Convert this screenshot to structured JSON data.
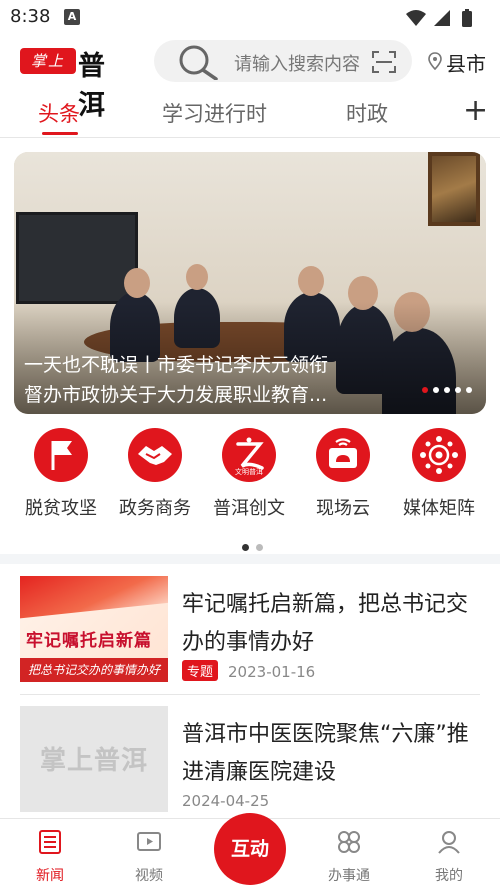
{
  "status_bar": {
    "time": "8:38",
    "notification_icon": "A"
  },
  "header": {
    "logo_badge": "掌上",
    "logo_name": "普洱",
    "search_placeholder": "请输入搜索内容",
    "location_label": "县市"
  },
  "tabs": [
    {
      "label": "头条",
      "active": true
    },
    {
      "label": "学习进行时",
      "active": false
    },
    {
      "label": "时政",
      "active": false
    }
  ],
  "banner": {
    "caption_line1": "一天也不耽误丨市委书记李庆元领衔",
    "caption_line2": "督办市政协关于大力发展职业教育...",
    "slide_count": 5,
    "active_slide": 1
  },
  "shortcuts": [
    {
      "label": "脱贫攻坚",
      "icon": "flag-icon"
    },
    {
      "label": "政务商务",
      "icon": "handshake-icon"
    },
    {
      "label": "普洱创文",
      "icon": "civilization-icon",
      "icon_text": "文明普洱"
    },
    {
      "label": "现场云",
      "icon": "live-cloud-icon"
    },
    {
      "label": "媒体矩阵",
      "icon": "media-matrix-icon"
    }
  ],
  "shortcut_pages": 2,
  "news": [
    {
      "title": "牢记嘱托启新篇，把总书记交办的事情办好",
      "tag": "专题",
      "date": "2023-01-16",
      "thumb_line1": "牢记嘱托启新篇",
      "thumb_line2": "把总书记交办的事情办好"
    },
    {
      "title": "普洱市中医医院聚焦“六廉”推进清廉医院建设",
      "tag": "",
      "date": "2024-04-25",
      "thumb_placeholder": "掌上普洱"
    }
  ],
  "bottom_nav": [
    {
      "label": "新闻",
      "icon": "news-icon",
      "active": true
    },
    {
      "label": "视频",
      "icon": "video-icon",
      "active": false
    },
    {
      "label": "互动",
      "icon": "interact-button",
      "active": false
    },
    {
      "label": "办事通",
      "icon": "services-icon",
      "active": false
    },
    {
      "label": "我的",
      "icon": "profile-icon",
      "active": false
    }
  ],
  "colors": {
    "brand": "#e0161d",
    "text": "#222222",
    "muted": "#888888",
    "divider": "#e6e6e6"
  }
}
